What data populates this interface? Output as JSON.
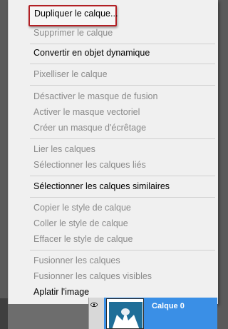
{
  "menu": {
    "items": [
      {
        "label": "Dupliquer le calque...",
        "enabled": true
      },
      {
        "label": "Supprimer le calque",
        "enabled": false
      },
      {
        "label": "Convertir en objet dynamique",
        "enabled": true
      },
      {
        "label": "Pixelliser le calque",
        "enabled": false
      },
      {
        "label": "Désactiver le masque de fusion",
        "enabled": false
      },
      {
        "label": "Activer le masque vectoriel",
        "enabled": false
      },
      {
        "label": "Créer un masque d'écrêtage",
        "enabled": false
      },
      {
        "label": "Lier les calques",
        "enabled": false
      },
      {
        "label": "Sélectionner les calques liés",
        "enabled": false
      },
      {
        "label": "Sélectionner les calques similaires",
        "enabled": true
      },
      {
        "label": "Copier le style de calque",
        "enabled": false
      },
      {
        "label": "Coller le style de calque",
        "enabled": false
      },
      {
        "label": "Effacer le style de calque",
        "enabled": false
      },
      {
        "label": "Fusionner les calques",
        "enabled": false
      },
      {
        "label": "Fusionner les calques visibles",
        "enabled": false
      },
      {
        "label": "Aplatir l'image",
        "enabled": true
      }
    ]
  },
  "layers_panel": {
    "layer_name": "Calque 0",
    "visibility_icon": "eye-icon"
  },
  "colors": {
    "highlight_border": "#b21f24",
    "selected_layer": "#3a8fe6"
  }
}
